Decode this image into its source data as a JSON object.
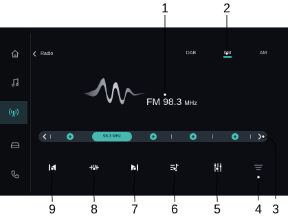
{
  "header": {
    "back_label": "Radio"
  },
  "bands": [
    {
      "label": "DAB",
      "active": false
    },
    {
      "label": "FM",
      "active": true
    },
    {
      "label": "AM",
      "active": false
    }
  ],
  "sidebar": {
    "items": [
      {
        "icon": "home-icon",
        "active": false
      },
      {
        "icon": "music-note-icon",
        "active": false
      },
      {
        "icon": "radio-broadcast-icon",
        "active": true
      },
      {
        "icon": "car-icon",
        "active": false
      },
      {
        "icon": "phone-icon",
        "active": false
      }
    ]
  },
  "station": {
    "band": "FM",
    "frequency": "98.3",
    "unit": "MHz"
  },
  "tuner": {
    "current": "98.3 MHz",
    "presets_count": 4
  },
  "controls": [
    {
      "icon": "seek-back-icon"
    },
    {
      "icon": "scan-icon"
    },
    {
      "icon": "seek-forward-icon"
    },
    {
      "icon": "add-favorite-icon"
    },
    {
      "icon": "equalizer-settings-icon"
    },
    {
      "icon": "list-icon"
    }
  ],
  "callouts": [
    "1",
    "2",
    "3",
    "4",
    "5",
    "6",
    "7",
    "8",
    "9"
  ],
  "colors": {
    "accent": "#3bd1c8",
    "background": "#0b0d12",
    "tuner_bar": "#273038"
  }
}
